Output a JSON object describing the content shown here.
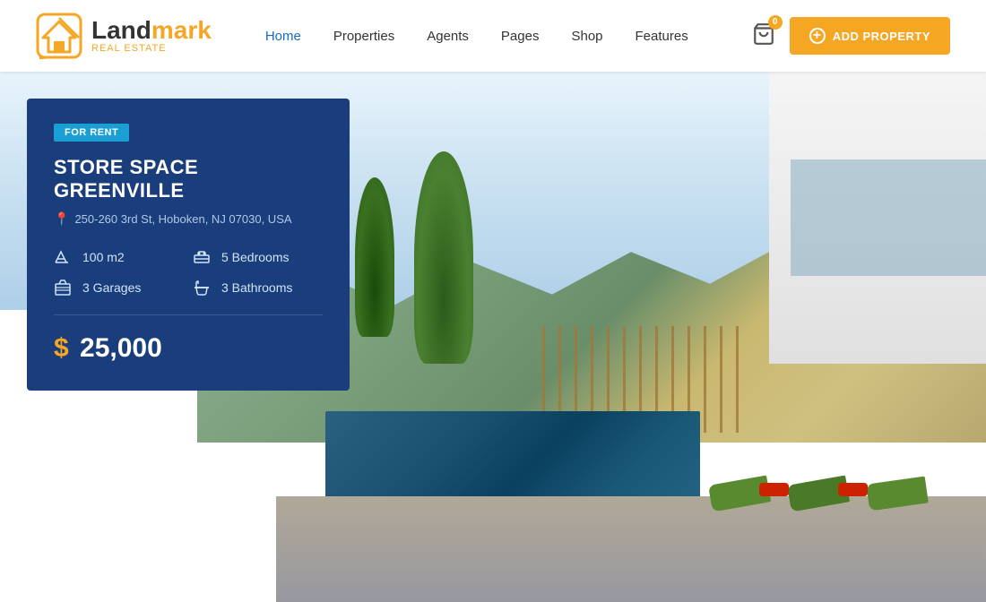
{
  "logo": {
    "land": "Land",
    "mark": "mark",
    "subtitle": "Real Estate"
  },
  "nav": {
    "items": [
      {
        "label": "Home",
        "active": true
      },
      {
        "label": "Properties",
        "active": false
      },
      {
        "label": "Agents",
        "active": false
      },
      {
        "label": "Pages",
        "active": false
      },
      {
        "label": "Shop",
        "active": false
      },
      {
        "label": "Features",
        "active": false
      }
    ]
  },
  "cart": {
    "badge": "0"
  },
  "add_property_btn": "ADD PROPERTY",
  "property": {
    "badge": "FOR RENT",
    "title": "STORE SPACE GREENVILLE",
    "address": "250-260 3rd St, Hoboken, NJ 07030, USA",
    "features": [
      {
        "icon": "area",
        "label": "100 m2"
      },
      {
        "icon": "bed",
        "label": "5 Bedrooms"
      },
      {
        "icon": "garage",
        "label": "3 Garages"
      },
      {
        "icon": "bath",
        "label": "3 Bathrooms"
      }
    ],
    "price_symbol": "$",
    "price": "25,000"
  }
}
